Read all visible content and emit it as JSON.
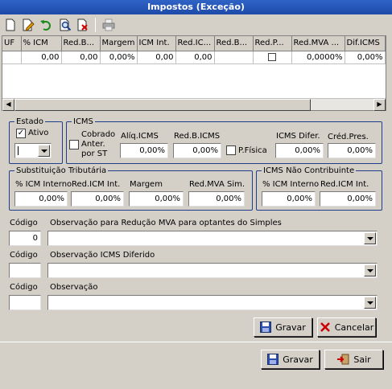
{
  "window": {
    "title": "Impostos (Exceção)"
  },
  "toolbar": {
    "icons": [
      "new-doc-icon",
      "edit-icon",
      "undo-icon",
      "search-icon",
      "delete-doc-icon",
      "print-icon"
    ]
  },
  "grid": {
    "columns": [
      "UF",
      "% ICM",
      "Red.B...",
      "Margem",
      "ICM Int.",
      "Red.IC...",
      "Red.B...",
      "Red.P...",
      "Red.MVA ...",
      "Dif.ICMS"
    ],
    "row": [
      "",
      "0,00",
      "0,00",
      "0,00%",
      "0,00",
      "0,00",
      "",
      "",
      "0,0000%",
      "0,00%"
    ]
  },
  "estado": {
    "legend": "Estado",
    "ativo_label": "Ativo",
    "ativo_checked": true,
    "uf_value": ""
  },
  "icms": {
    "legend": "ICMS",
    "cobrado_label": "Cobrado Anter. por ST",
    "aliq_label": "Alíq.ICMS",
    "aliq_value": "0,00%",
    "redb_label": "Red.B.ICMS",
    "redb_value": "0,00%",
    "pfisica_label": "P.Física",
    "difer_label": "ICMS Difer.",
    "difer_value": "0,00%",
    "credpres_label": "Créd.Pres.",
    "credpres_value": "0,00%"
  },
  "st": {
    "legend": "Substituição Tributária",
    "icm_interno_label": "% ICM Interno",
    "icm_interno_value": "0,00%",
    "red_icm_int_label": "Red.ICM Int.",
    "red_icm_int_value": "0,00%",
    "margem_label": "Margem",
    "margem_value": "0,00%",
    "red_mva_label": "Red.MVA Sim.",
    "red_mva_value": "0,00%"
  },
  "nc": {
    "legend": "ICMS Não Contribuinte",
    "icm_interno_label": "% ICM Interno",
    "icm_interno_value": "0,00%",
    "red_icm_int_label": "Red.ICM Int.",
    "red_icm_int_value": "0,00%"
  },
  "obs1": {
    "codigo_label": "Código",
    "codigo_value": "0",
    "label": "Observação para Redução MVA para optantes do Simples",
    "value": ""
  },
  "obs2": {
    "codigo_label": "Código",
    "codigo_value": "",
    "label": "Observação ICMS Diferido",
    "value": ""
  },
  "obs3": {
    "codigo_label": "Código",
    "codigo_value": "",
    "label": "Observação",
    "value": ""
  },
  "inner_buttons": {
    "gravar": "Gravar",
    "cancelar": "Cancelar"
  },
  "footer_buttons": {
    "gravar": "Gravar",
    "sair": "Sair"
  },
  "colors": {
    "title_bar": "#1e4aa8",
    "group_border": "#1f3f8a",
    "cancel_x": "#cc0000"
  }
}
